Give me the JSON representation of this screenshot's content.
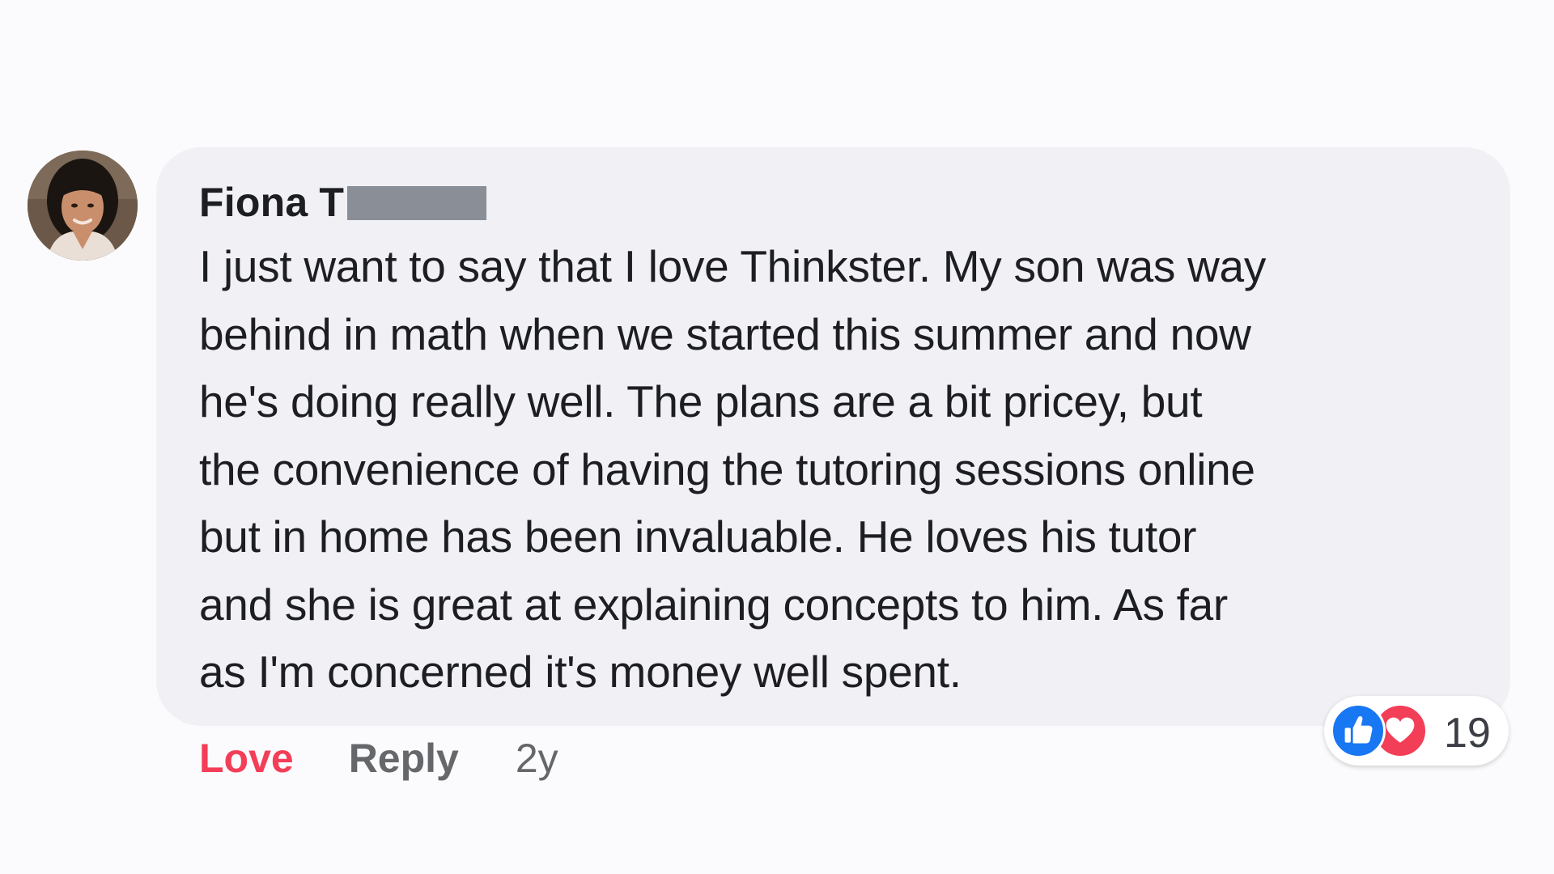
{
  "comment": {
    "author_name": "Fiona T",
    "text_lines": [
      "I just want to say that I love Thinkster. My son was way",
      "behind in math when we started this summer and now",
      "he's doing really well. The plans are a bit pricey, but",
      "the convenience of having the tutoring sessions online",
      "but in home has been invaluable. He loves his tutor",
      "and she is great at explaining concepts to him. As far",
      "as I'm concerned it's money well spent."
    ],
    "reactions": {
      "count": "19",
      "icons": [
        "like-icon",
        "love-icon"
      ]
    },
    "actions": {
      "love_label": "Love",
      "reply_label": "Reply",
      "timestamp": "2y"
    }
  },
  "colors": {
    "background": "#fbfbfd",
    "bubble": "#f0f0f5",
    "text": "#1c1e21",
    "secondary_text": "#65676b",
    "love_red": "#f33e58",
    "like_blue": "#1877f2",
    "redaction": "#8a8e97"
  }
}
